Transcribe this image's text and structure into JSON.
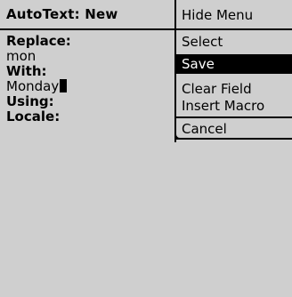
{
  "screen": {
    "title": "AutoText: New"
  },
  "fields": {
    "replace_label": "Replace:",
    "replace_value": "mon",
    "with_label": "With:",
    "with_value": "Monday",
    "using_label": "Using:",
    "locale_label": "Locale:"
  },
  "menu": {
    "items": [
      {
        "label": "Hide Menu"
      },
      {
        "label": "Select"
      },
      {
        "label": "Save",
        "selected": true
      },
      {
        "label": "Clear Field"
      },
      {
        "label": "Insert Macro"
      },
      {
        "label": "Cancel"
      }
    ]
  }
}
